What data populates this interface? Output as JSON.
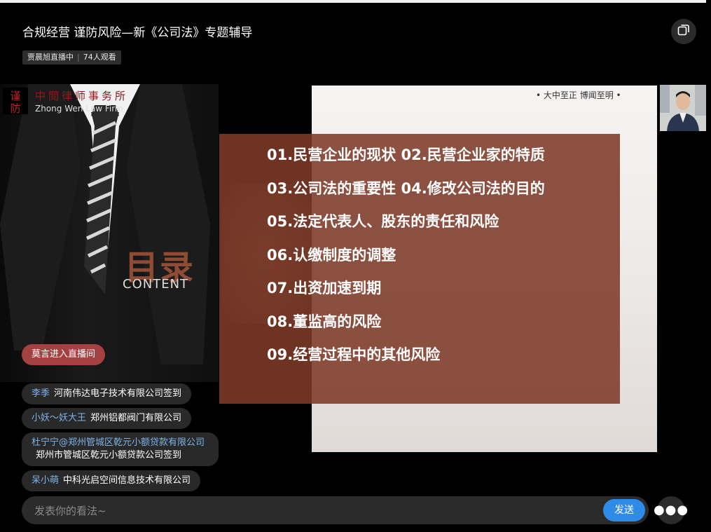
{
  "header": {
    "title": "合规经营 谨防风险—新《公司法》专题辅导",
    "host_status": "贾晨旭直播中",
    "viewers": "74人观看"
  },
  "slide": {
    "firm_name": "中閲律师事务所",
    "firm_en": "Zhong Wen Law Firm",
    "logo_text": "谨防",
    "slogan": "•  大中至正  博闻至明  •",
    "mulu": "目录",
    "content_word": "CONTENT",
    "toc": [
      "01.民营企业的现状  02.民营企业家的特质",
      "03.公司法的重要性  04.修改公司法的目的",
      "05.法定代表人、股东的责任和风险",
      "06.认缴制度的调整",
      "07.出资加速到期",
      "08.董监高的风险",
      "09.经营过程中的其他风险"
    ]
  },
  "chat": {
    "enter_notice": "莫言进入直播间",
    "messages": [
      {
        "user": "李季",
        "text": "河南伟达电子技术有限公司签到"
      },
      {
        "user": "小妖～妖大王",
        "text": "郑州铝都阀门有限公司"
      },
      {
        "user": "杜宁宁@郑州管城区乾元小额贷款有限公司",
        "text": "郑州市管城区乾元小额贷款公司签到"
      },
      {
        "user": "呆小萌",
        "text": "中科光启空间信息技术有限公司"
      }
    ]
  },
  "input": {
    "placeholder": "发表你的看法~",
    "send_label": "发送"
  },
  "icons": {
    "pip": "picture-in-picture-icon",
    "more": "more-dots-icon"
  },
  "colors": {
    "accent_blue": "#2e8ce8",
    "enter_red": "#a64141",
    "toc_brown": "#7d3a28",
    "username_blue": "#7fb3e8"
  }
}
